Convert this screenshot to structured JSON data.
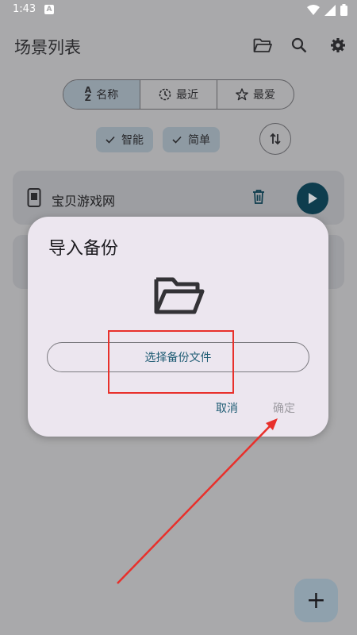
{
  "status": {
    "time": "1:43",
    "notification_letter": "A"
  },
  "appbar": {
    "title": "场景列表",
    "icons": [
      "folder-icon",
      "search-icon",
      "gear-icon"
    ]
  },
  "segments": [
    {
      "label": "名称",
      "icon": "sort-az-icon",
      "selected": true
    },
    {
      "label": "最近",
      "icon": "history-icon",
      "selected": false
    },
    {
      "label": "最爱",
      "icon": "star-icon",
      "selected": false
    }
  ],
  "chips": [
    {
      "label": "智能",
      "checked": true
    },
    {
      "label": "简单",
      "checked": true
    }
  ],
  "scene": {
    "name": "宝贝游戏网"
  },
  "dialog": {
    "title": "导入备份",
    "choose_label": "选择备份文件",
    "cancel_label": "取消",
    "ok_label": "确定"
  },
  "fab": {
    "label": "+"
  },
  "colors": {
    "annotation": "#e8302b",
    "accent": "#1f5c74",
    "play_button": "#0e3d4e"
  }
}
